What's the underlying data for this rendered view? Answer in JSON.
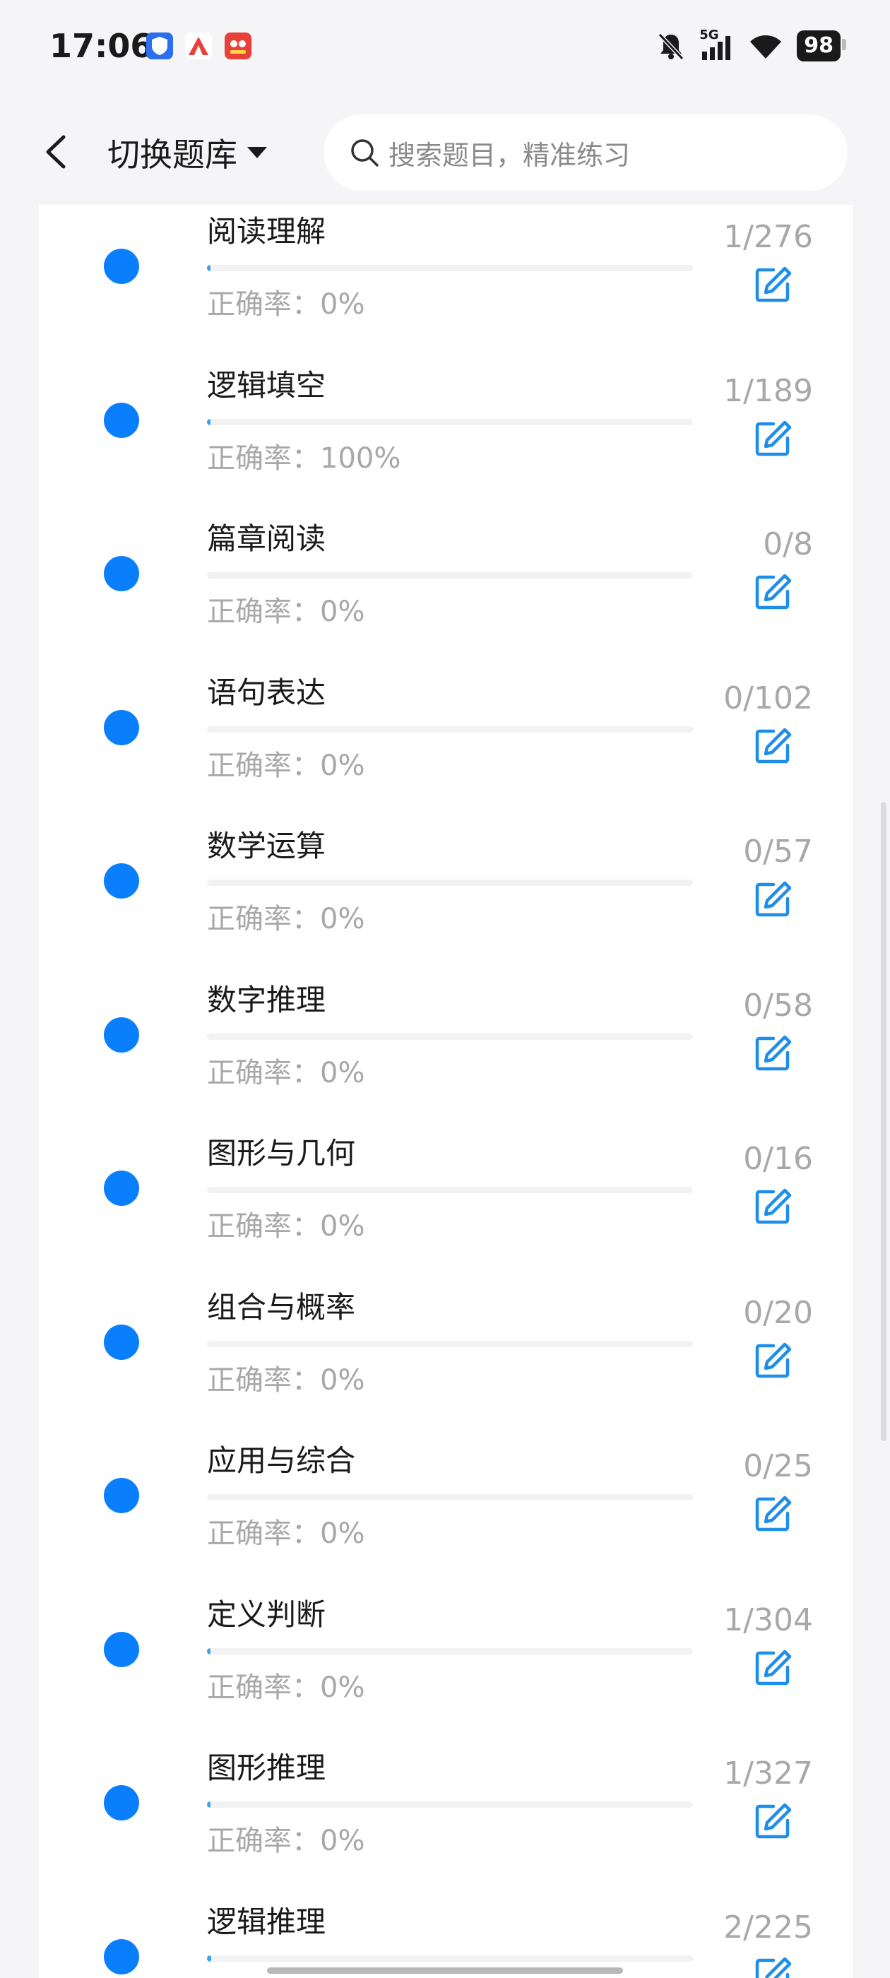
{
  "status": {
    "time": "17:06",
    "network": "5G",
    "battery": "98",
    "app_icons": [
      "blue-shield-app-icon",
      "red-tent-app-icon",
      "red-game-app-icon"
    ],
    "icons": [
      "mute-bell-icon",
      "signal-icon",
      "wifi-icon"
    ]
  },
  "header": {
    "title": "切换题库",
    "search_placeholder": "搜索题目，精准练习"
  },
  "categories": [
    {
      "name": "阅读理解",
      "accuracy": "正确率：0%",
      "count": "1/276",
      "progress": 0.0036
    },
    {
      "name": "逻辑填空",
      "accuracy": "正确率：100%",
      "count": "1/189",
      "progress": 0.0053
    },
    {
      "name": "篇章阅读",
      "accuracy": "正确率：0%",
      "count": "0/8",
      "progress": 0
    },
    {
      "name": "语句表达",
      "accuracy": "正确率：0%",
      "count": "0/102",
      "progress": 0
    },
    {
      "name": "数学运算",
      "accuracy": "正确率：0%",
      "count": "0/57",
      "progress": 0
    },
    {
      "name": "数字推理",
      "accuracy": "正确率：0%",
      "count": "0/58",
      "progress": 0
    },
    {
      "name": "图形与几何",
      "accuracy": "正确率：0%",
      "count": "0/16",
      "progress": 0
    },
    {
      "name": "组合与概率",
      "accuracy": "正确率：0%",
      "count": "0/20",
      "progress": 0
    },
    {
      "name": "应用与综合",
      "accuracy": "正确率：0%",
      "count": "0/25",
      "progress": 0
    },
    {
      "name": "定义判断",
      "accuracy": "正确率：0%",
      "count": "1/304",
      "progress": 0.0033
    },
    {
      "name": "图形推理",
      "accuracy": "正确率：0%",
      "count": "1/327",
      "progress": 0.0031
    },
    {
      "name": "逻辑推理",
      "accuracy": "",
      "count": "2/225",
      "progress": 0.0089
    }
  ],
  "colors": {
    "accent": "#0a7ffd",
    "progress_fill": "#3aa0f0",
    "muted_text": "#a8a8a8",
    "edit_icon": "#1f8ee8"
  }
}
